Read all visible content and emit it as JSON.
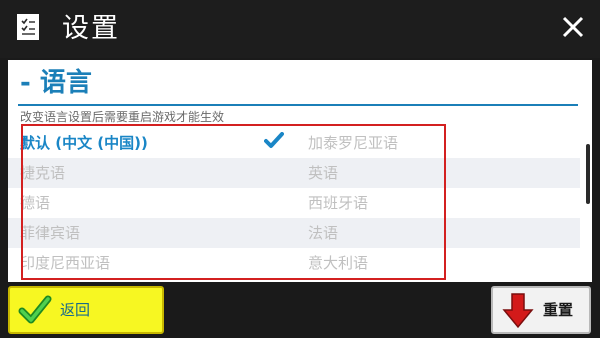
{
  "window": {
    "title": "设置"
  },
  "section": {
    "title": "- 语言",
    "hint": "改变语言设置后需要重启游戏才能生效"
  },
  "languages": {
    "left": [
      "默认 (中文 (中国))",
      "捷克语",
      "德语",
      "菲律宾语",
      "印度尼西亚语"
    ],
    "right": [
      "加泰罗尼亚语",
      "英语",
      "西班牙语",
      "法语",
      "意大利语"
    ],
    "selected": "默认 (中文 (中国))"
  },
  "buttons": {
    "back_label": "返回",
    "reset_label": "重置"
  },
  "icons": {
    "app": "checklist-icon",
    "close": "close-icon",
    "selected": "checkmark-icon",
    "back": "green-check-icon",
    "reset": "red-down-arrow-icon"
  },
  "colors": {
    "accent": "#1b7fb8",
    "highlight_border": "#d32020",
    "back_button": "#f7f722",
    "check_green": "#22a82a",
    "reset_arrow": "#d31a1a"
  }
}
